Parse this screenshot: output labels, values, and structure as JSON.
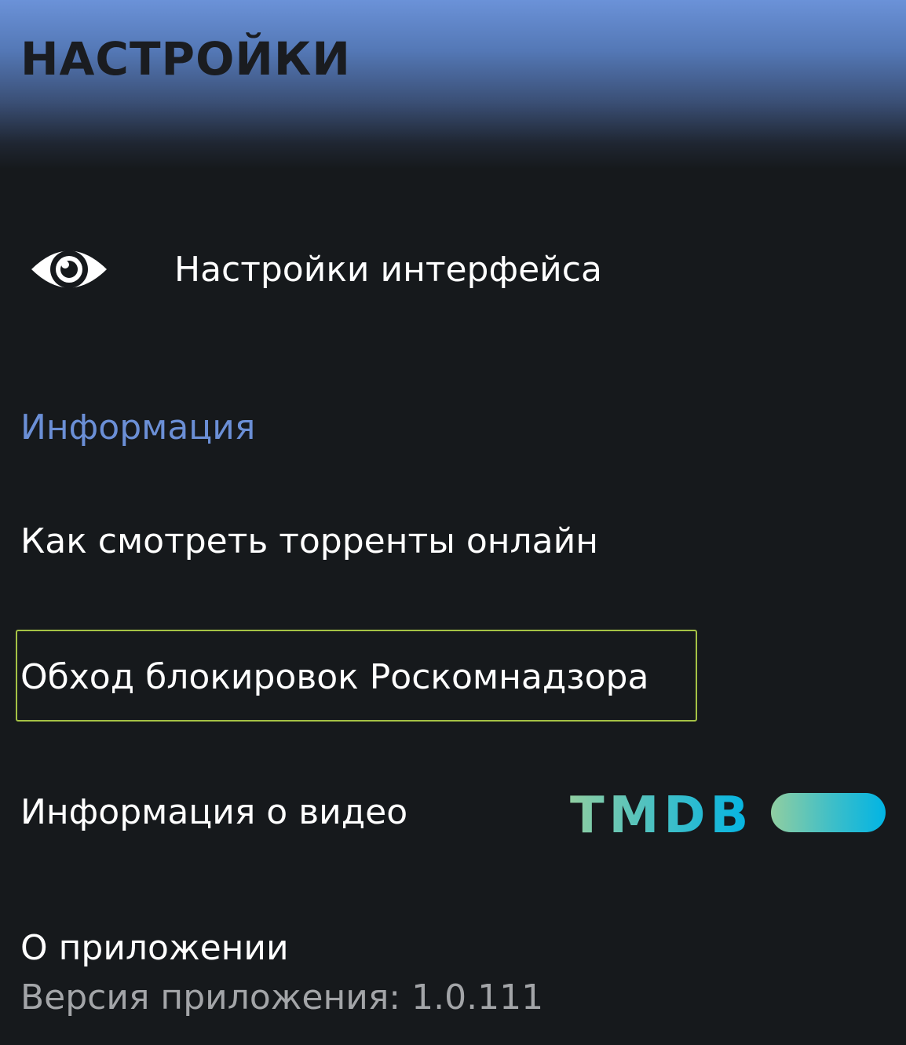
{
  "header": {
    "title": "НАСТРОЙКИ"
  },
  "interface_settings": {
    "label": "Настройки интерфейса",
    "icon": "eye-icon"
  },
  "info_section": {
    "title": "Информация",
    "title_color": "#6b8fd6"
  },
  "items": {
    "torrents": "Как смотреть торренты онлайн",
    "bypass": "Обход блокировок Роскомнадзора",
    "video_info": "Информация о видео",
    "about": "О приложении",
    "version": "Версия приложения: 1.0.111"
  },
  "tmdb": {
    "logo_text": "TMDB",
    "gradient_start": "#90cea1",
    "gradient_end": "#01b4e4"
  },
  "focus_color": "#a5c245"
}
